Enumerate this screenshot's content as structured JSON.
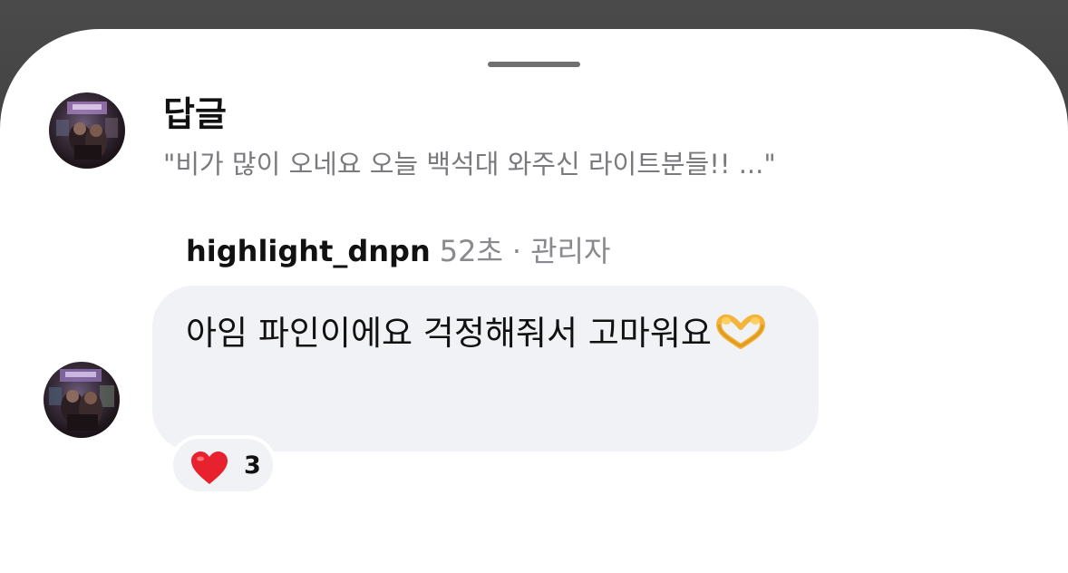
{
  "header": {
    "title": "답글",
    "quoted_comment": "\"비가 많이 오네요 오늘 백석대 와주신 라이트분들!! ...\""
  },
  "reply": {
    "username": "highlight_dnpn",
    "timestamp": "52초",
    "separator": "·",
    "role": "관리자",
    "message": "아임 파인이에요 걱정해줘서 고마워요",
    "emoji": "heart-hands-icon"
  },
  "reaction": {
    "icon": "heart-icon",
    "count": "3"
  },
  "colors": {
    "bubble": "#f1f2f5",
    "heart": "#e8212e",
    "secondary_text": "#7a7a7e"
  }
}
